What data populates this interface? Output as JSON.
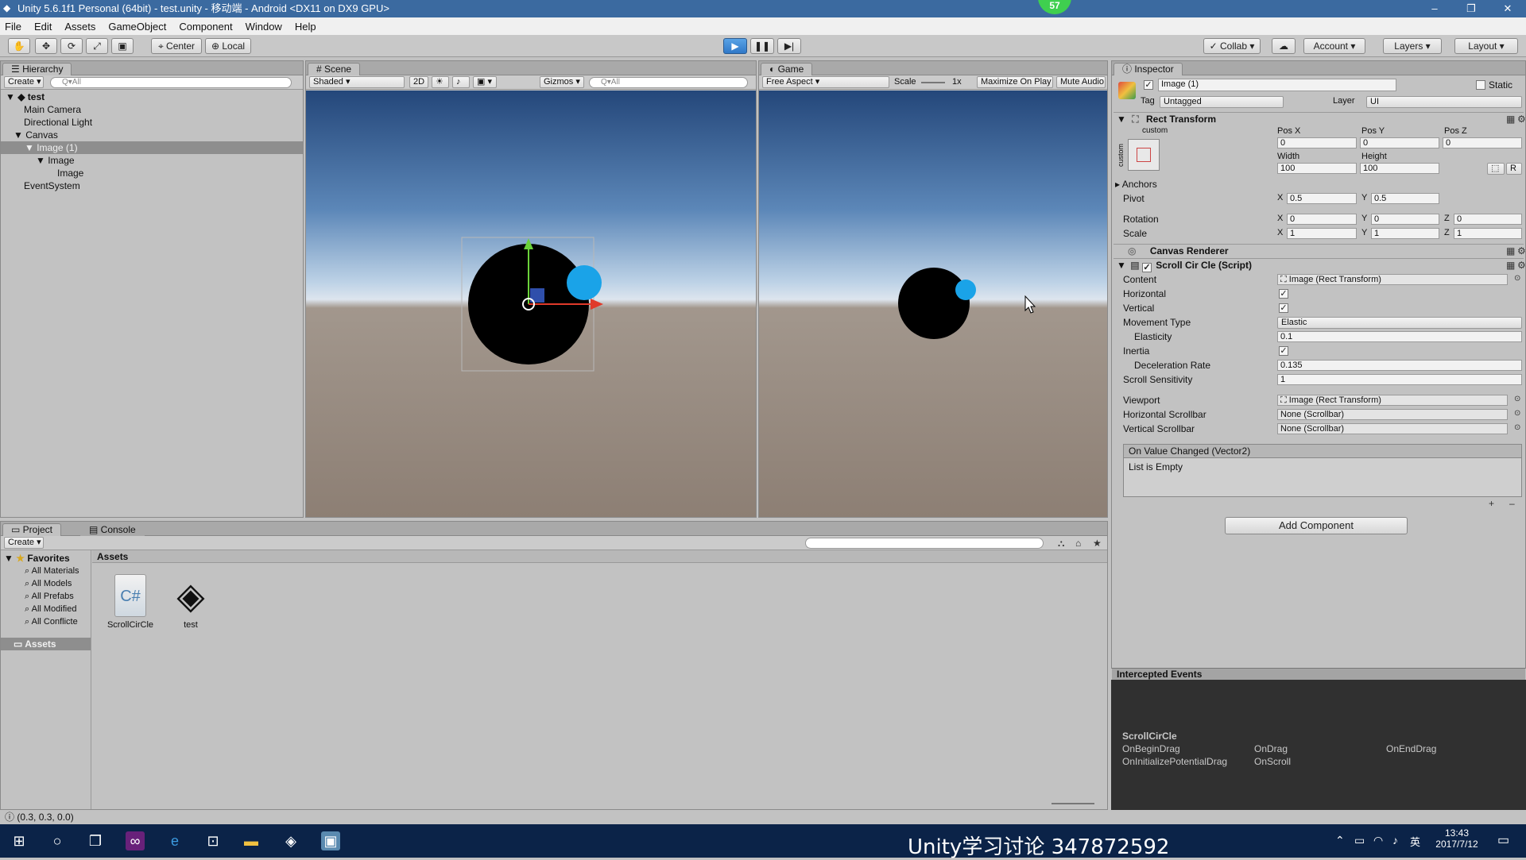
{
  "window": {
    "title": "Unity 5.6.1f1 Personal (64bit) - test.unity - 移动端 - Android <DX11 on DX9 GPU>",
    "badge": "57",
    "minimize": "–",
    "maximize": "❐",
    "close": "✕"
  },
  "menu": [
    "File",
    "Edit",
    "Assets",
    "GameObject",
    "Component",
    "Window",
    "Help"
  ],
  "toolbar": {
    "center": "Center",
    "local": "Local",
    "collab": "Collab",
    "account": "Account",
    "layers": "Layers",
    "layout": "Layout"
  },
  "hierarchy": {
    "tab": "Hierarchy",
    "create": "Create",
    "search_placeholder": "Q▾All",
    "scene": "test",
    "items": [
      {
        "label": "Main Camera"
      },
      {
        "label": "Directional Light"
      },
      {
        "label": "Canvas"
      },
      {
        "label": "Image (1)"
      },
      {
        "label": "Image"
      },
      {
        "label": "Image"
      },
      {
        "label": "EventSystem"
      }
    ]
  },
  "scene": {
    "tab": "Scene",
    "shading": "Shaded",
    "mode2d": "2D",
    "gizmos": "Gizmos",
    "search_placeholder": "Q▾All"
  },
  "game": {
    "tab": "Game",
    "aspect": "Free Aspect",
    "scale_label": "Scale",
    "scale_value": "1x",
    "maximize": "Maximize On Play",
    "mute": "Mute Audio"
  },
  "inspector": {
    "tab": "Inspector",
    "object_name": "Image (1)",
    "static_label": "Static",
    "tag_label": "Tag",
    "tag_value": "Untagged",
    "layer_label": "Layer",
    "layer_value": "UI",
    "rect": {
      "title": "Rect Transform",
      "custom": "custom",
      "custom_v": "custom",
      "posx_label": "Pos X",
      "posy_label": "Pos Y",
      "posz_label": "Pos Z",
      "posx": "0",
      "posy": "0",
      "posz": "0",
      "width_label": "Width",
      "height_label": "Height",
      "width": "100",
      "height": "100",
      "r_btn": "R",
      "anchors": "Anchors",
      "pivot": "Pivot",
      "pivot_x": "0.5",
      "pivot_y": "0.5",
      "rotation": "Rotation",
      "rot_x": "0",
      "rot_y": "0",
      "rot_z": "0",
      "scale": "Scale",
      "scale_x": "1",
      "scale_y": "1",
      "scale_z": "1",
      "x": "X",
      "y": "Y",
      "z": "Z"
    },
    "canvas_renderer": "Canvas Renderer",
    "script": {
      "title": "Scroll Cir Cle (Script)",
      "content_label": "Content",
      "content_value": "Image (Rect Transform)",
      "horizontal_label": "Horizontal",
      "vertical_label": "Vertical",
      "movement_label": "Movement Type",
      "movement_value": "Elastic",
      "elasticity_label": "Elasticity",
      "elasticity_value": "0.1",
      "inertia_label": "Inertia",
      "decel_label": "Deceleration Rate",
      "decel_value": "0.135",
      "sensitivity_label": "Scroll Sensitivity",
      "sensitivity_value": "1",
      "viewport_label": "Viewport",
      "viewport_value": "Image (Rect Transform)",
      "hscroll_label": "Horizontal Scrollbar",
      "hscroll_value": "None (Scrollbar)",
      "vscroll_label": "Vertical Scrollbar",
      "vscroll_value": "None (Scrollbar)",
      "event_title": "On Value Changed (Vector2)",
      "event_empty": "List is Empty",
      "plus": "+",
      "minus": "–"
    },
    "add_component": "Add Component",
    "intercepted": {
      "title": "Intercepted Events",
      "component": "ScrollCirCle",
      "events": [
        "OnBeginDrag",
        "OnDrag",
        "OnEndDrag",
        "OnInitializePotentialDrag",
        "OnScroll"
      ]
    }
  },
  "project": {
    "tab": "Project",
    "console_tab": "Console",
    "create": "Create",
    "favorites": "Favorites",
    "fav_items": [
      "All Materials",
      "All Models",
      "All Prefabs",
      "All Modified",
      "All Conflicte"
    ],
    "assets_root": "Assets",
    "assets_header": "Assets",
    "files": [
      {
        "name": "ScrollCirCle"
      },
      {
        "name": "test"
      }
    ]
  },
  "status": {
    "text": "(0.3, 0.3, 0.0)"
  },
  "taskbar": {
    "overlay_text": "Unity学习讨论 347872592",
    "time": "13:43",
    "date": "2017/7/12",
    "ime": "英"
  }
}
